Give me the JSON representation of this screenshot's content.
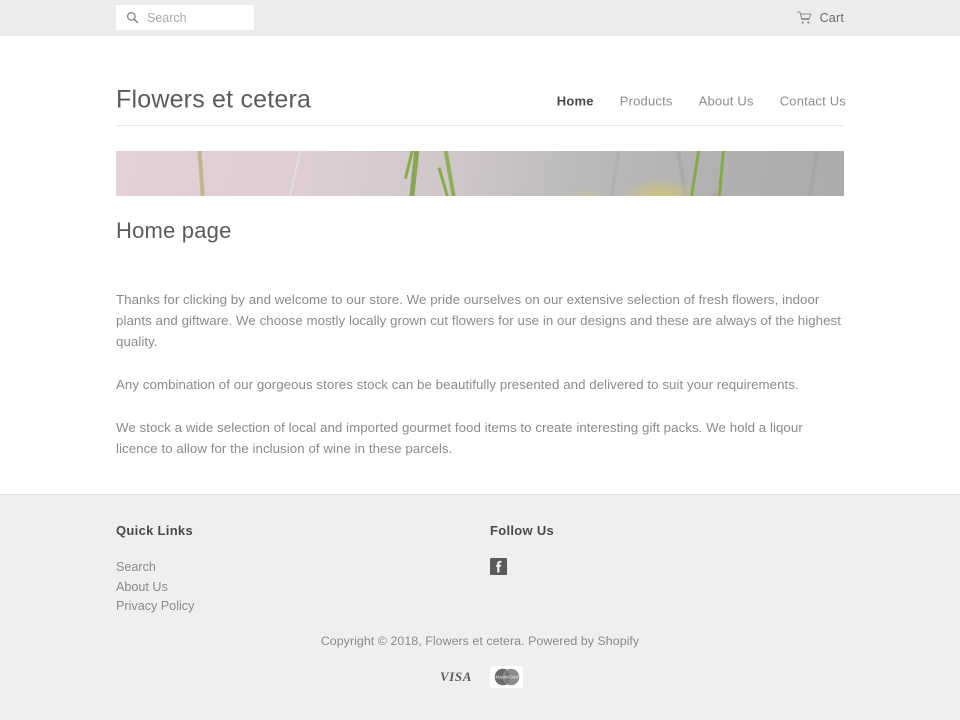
{
  "topbar": {
    "search": {
      "icon": "search-icon",
      "placeholder": "Search",
      "value": ""
    },
    "cart": {
      "icon": "shopping-cart-icon",
      "label": "Cart"
    }
  },
  "header": {
    "site_title": "Flowers et cetera",
    "nav": [
      {
        "label": "Home",
        "active": true
      },
      {
        "label": "Products",
        "active": false
      },
      {
        "label": "About Us",
        "active": false
      },
      {
        "label": "Contact Us",
        "active": false
      }
    ]
  },
  "hero": {
    "alt": "close-up photo of flower stems against a pale pink and grey background",
    "colors": {
      "left": "#e2d2d6",
      "right": "#acacac",
      "stem": "#7fa83e"
    }
  },
  "main": {
    "page_title": "Home page",
    "paragraphs": [
      "Thanks for clicking by and welcome to our store. We pride ourselves on our extensive selection of fresh flowers, indoor plants and giftware. We choose mostly locally grown cut flowers for use in our designs and these are always of the highest quality.",
      "Any combination of our gorgeous stores stock can be beautifully presented and delivered to suit your requirements.",
      "We stock a wide selection of local and imported gourmet food items to create interesting gift packs. We hold a liqour licence to allow for the inclusion of wine in these parcels."
    ]
  },
  "footer": {
    "quick_links": {
      "heading": "Quick Links",
      "items": [
        {
          "label": "Search"
        },
        {
          "label": "About Us"
        },
        {
          "label": "Privacy Policy"
        }
      ]
    },
    "follow_us": {
      "heading": "Follow Us",
      "social": [
        {
          "name": "facebook-icon",
          "label": "Facebook"
        }
      ]
    },
    "copyright": "Copyright © 2018, Flowers et cetera. Powered by Shopify",
    "payment_methods": [
      {
        "name": "visa-icon",
        "label": "VISA"
      },
      {
        "name": "mastercard-icon",
        "label": "MasterCard"
      }
    ],
    "colors": {
      "background": "#efefef",
      "heading": "#4a4a4a",
      "text": "#8a8a8a"
    }
  }
}
